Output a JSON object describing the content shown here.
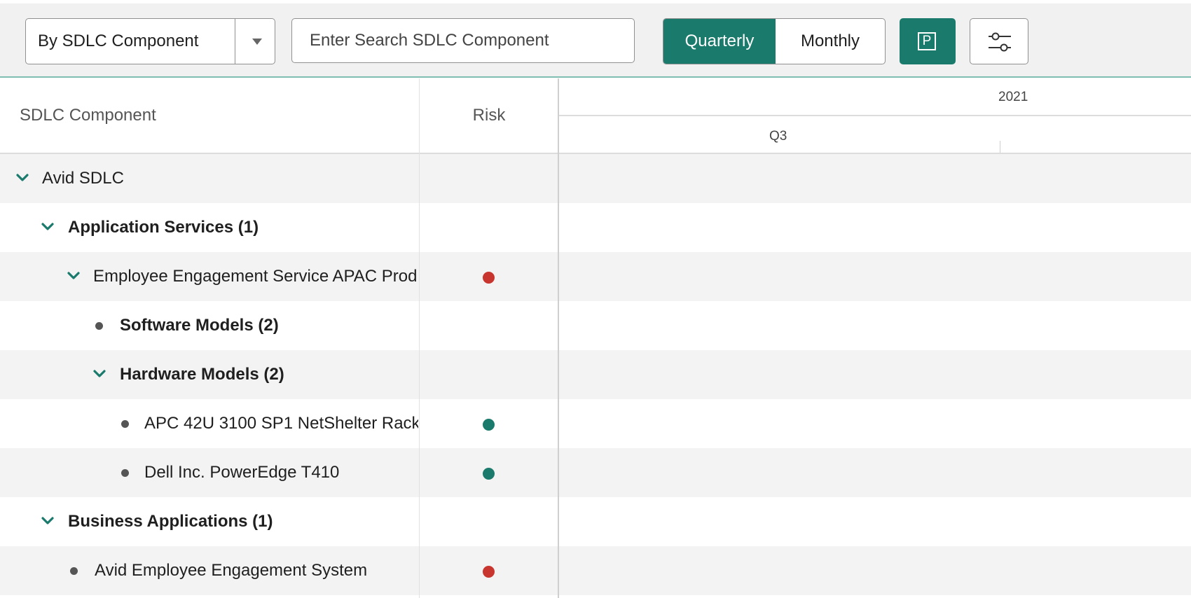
{
  "toolbar": {
    "group_by": "By SDLC Component",
    "search_placeholder": "Enter Search SDLC Component",
    "view_options": [
      "Quarterly",
      "Monthly"
    ],
    "active_view": "Quarterly",
    "planning_button_letter": "P",
    "filter_icon": "sliders-icon",
    "accent_color": "#1a7a6c"
  },
  "grid": {
    "columns": {
      "component": "SDLC Component",
      "risk": "Risk"
    },
    "timeline": {
      "year": "2021",
      "quarter": "Q3"
    },
    "rows": [
      {
        "label": "Avid SDLC",
        "level": 0,
        "bold": false,
        "toggle": "expanded",
        "risk": null
      },
      {
        "label": "Application Services (1)",
        "level": 1,
        "bold": true,
        "toggle": "expanded",
        "risk": null
      },
      {
        "label": "Employee Engagement Service APAC Prod",
        "level": 2,
        "bold": false,
        "toggle": "expanded",
        "risk": "high"
      },
      {
        "label": "Software Models (2)",
        "level": 3,
        "bold": true,
        "toggle": "leaf",
        "risk": null
      },
      {
        "label": "Hardware Models (2)",
        "level": 3,
        "bold": true,
        "toggle": "expanded",
        "risk": null
      },
      {
        "label": "APC 42U 3100 SP1 NetShelter Rack",
        "level": 4,
        "bold": false,
        "toggle": "leaf",
        "risk": "low"
      },
      {
        "label": "Dell Inc. PowerEdge T410",
        "level": 4,
        "bold": false,
        "toggle": "leaf",
        "risk": "low"
      },
      {
        "label": "Business Applications (1)",
        "level": 1,
        "bold": true,
        "toggle": "expanded",
        "risk": null
      },
      {
        "label": "Avid Employee Engagement System",
        "level": 2,
        "bold": false,
        "toggle": "leaf",
        "risk": "high"
      }
    ],
    "risk_colors": {
      "high": "#c8352e",
      "low": "#1a7a6c"
    }
  }
}
